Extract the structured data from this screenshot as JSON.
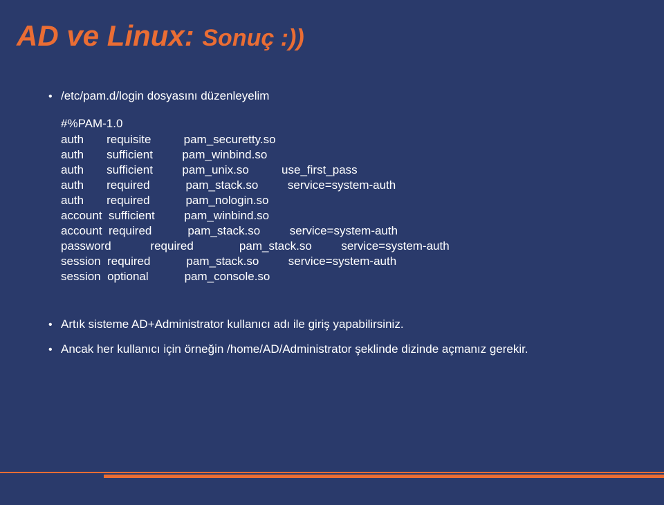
{
  "title": {
    "main": "AD ve Linux:",
    "sub": "Sonuç :))"
  },
  "bullets": {
    "b1": "/etc/pam.d/login dosyasını düzenleyelim",
    "b2": "Artık sisteme AD+Administrator kullanıcı adı ile giriş yapabilirsiniz.",
    "b3": "Ancak her kullanıcı için örneğin /home/AD/Administrator şeklinde dizinde açmanız gerekir."
  },
  "code": "#%PAM-1.0\nauth       requisite          pam_securetty.so\nauth       sufficient         pam_winbind.so\nauth       sufficient         pam_unix.so          use_first_pass\nauth       required           pam_stack.so         service=system-auth\nauth       required           pam_nologin.so\naccount  sufficient         pam_winbind.so\naccount  required           pam_stack.so         service=system-auth\npassword            required              pam_stack.so         service=system-auth\nsession  required           pam_stack.so         service=system-auth\nsession  optional           pam_console.so"
}
